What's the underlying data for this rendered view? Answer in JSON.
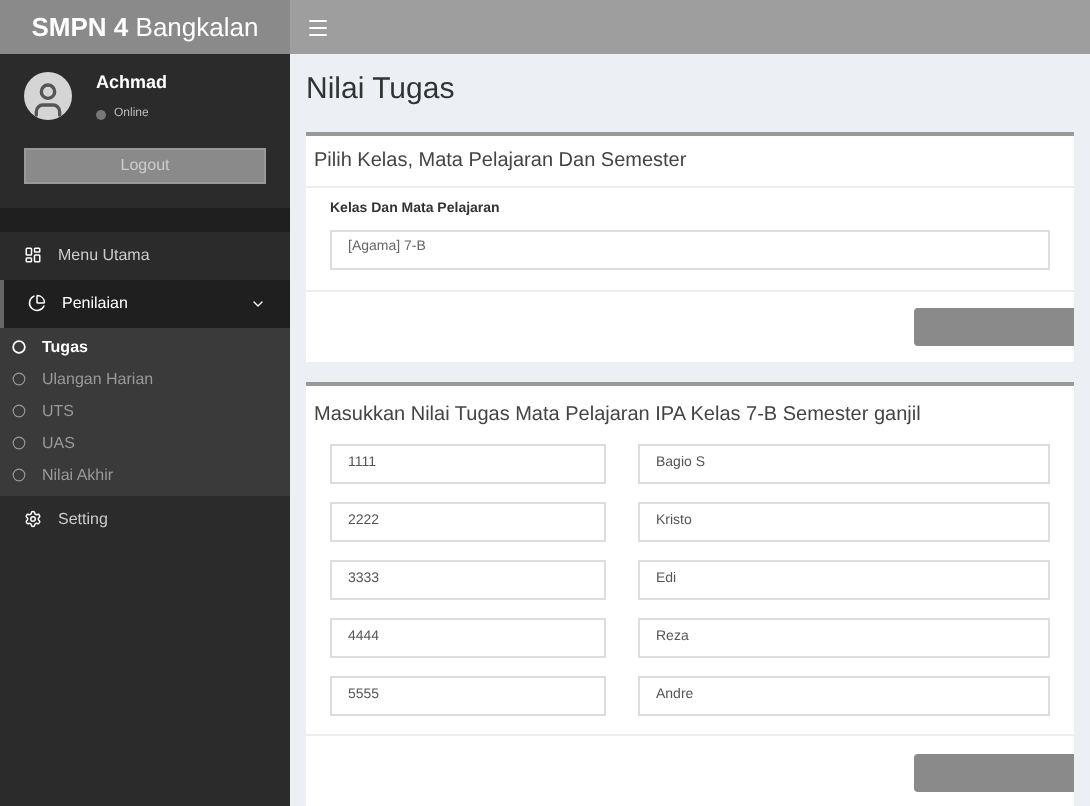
{
  "brand": "**SMPN 4** Bangkalan",
  "user": {
    "name": "Achmad",
    "status": "Online",
    "logout": "Logout"
  },
  "menu": [
    {
      "label": "Menu Utama",
      "expanded": false
    },
    {
      "label": "Penilaian",
      "expanded": true,
      "children": [
        {
          "label": "Tugas",
          "selected": true
        },
        {
          "label": "Ulangan Harian",
          "selected": false
        },
        {
          "label": "UTS",
          "selected": false
        },
        {
          "label": "UAS",
          "selected": false
        },
        {
          "label": "Nilai Akhir",
          "selected": false
        }
      ]
    },
    {
      "label": "Setting",
      "expanded": false
    }
  ],
  "page_title": "Nilai Tugas",
  "select_panel": {
    "title": "Pilih Kelas, Mata Pelajaran Dan Semester",
    "field_label": "Kelas Dan Mata Pelajaran",
    "field_value": "[Agama] 7-B"
  },
  "grades_panel": {
    "title": "Masukkan Nilai Tugas Mata Pelajaran IPA Kelas 7-B Semester ganjil",
    "rows": [
      {
        "id": "1111",
        "name": "Bagio S"
      },
      {
        "id": "2222",
        "name": "Kristo"
      },
      {
        "id": "3333",
        "name": "Edi"
      },
      {
        "id": "4444",
        "name": "Reza"
      },
      {
        "id": "5555",
        "name": "Andre"
      }
    ]
  }
}
